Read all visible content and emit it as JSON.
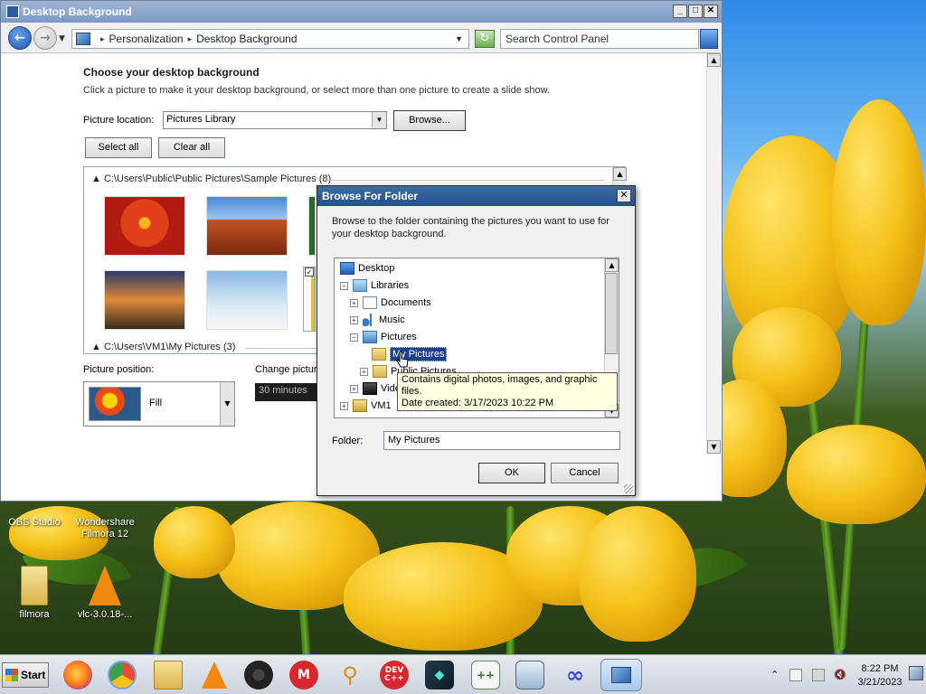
{
  "window": {
    "title": "Desktop Background",
    "buttons": {
      "minimize": "_",
      "maximize": "□",
      "close": "✕"
    }
  },
  "navbar": {
    "breadcrumb": [
      "Personalization",
      "Desktop Background"
    ],
    "search_placeholder": "Search Control Panel"
  },
  "page": {
    "heading": "Choose your desktop background",
    "instructions": "Click a picture to make it your desktop background, or select more than one picture to create a slide show.",
    "location_label": "Picture location:",
    "location_value": "Pictures Library",
    "browse_label": "Browse...",
    "select_all_label": "Select all",
    "clear_all_label": "Clear all",
    "groups": [
      {
        "label": "C:\\Users\\Public\\Public Pictures\\Sample Pictures (8)"
      },
      {
        "label": "C:\\Users\\VM1\\My Pictures (3)"
      }
    ],
    "position_label": "Picture position:",
    "position_value": "Fill",
    "change_label": "Change picture every:",
    "interval_value": "30 minutes"
  },
  "dialog": {
    "title": "Browse For Folder",
    "description": "Browse to the folder containing the pictures you want to use for your desktop background.",
    "tree": [
      {
        "label": "Desktop",
        "icon": "desktop-icon",
        "expander": ""
      },
      {
        "label": "Libraries",
        "icon": "libraries-icon",
        "expander": "−"
      },
      {
        "label": "Documents",
        "icon": "documents-icon",
        "expander": "+"
      },
      {
        "label": "Music",
        "icon": "music-icon",
        "expander": "+"
      },
      {
        "label": "Pictures",
        "icon": "pictures-icon",
        "expander": "−"
      },
      {
        "label": "My Pictures",
        "icon": "folder-icon",
        "expander": "",
        "selected": true
      },
      {
        "label": "Public Pictures",
        "icon": "folder-icon",
        "expander": "+"
      },
      {
        "label": "Videos",
        "icon": "video-icon",
        "expander": "+"
      },
      {
        "label": "VM1",
        "icon": "user-folder-icon",
        "expander": "+"
      }
    ],
    "tooltip_line1": "Contains digital photos, images, and graphic files.",
    "tooltip_line2": "Date created: 3/17/2023 10:22 PM",
    "folder_label": "Folder:",
    "folder_value": "My Pictures",
    "ok_label": "OK",
    "cancel_label": "Cancel"
  },
  "desktop_icons": [
    {
      "label": "OBS Studio",
      "icon": "obs-icon"
    },
    {
      "label": "Wondershare Filmora 12",
      "icon": "filmora-icon"
    },
    {
      "label": "filmora",
      "icon": "folder-icon"
    },
    {
      "label": "vlc-3.0.18-...",
      "icon": "vlc-icon"
    }
  ],
  "taskbar": {
    "start_label": "Start",
    "apps": [
      "firefox-icon",
      "chrome-icon",
      "file-explorer-icon",
      "vlc-icon",
      "obs-icon",
      "mega-icon",
      "search-tool-icon",
      "devcpp-icon",
      "filmora-icon",
      "notepadpp-icon",
      "window-app-icon",
      "infinity-app-icon",
      "control-panel-icon"
    ],
    "time": "8:22 PM",
    "date": "3/21/2023"
  },
  "colors": {
    "title_active": "#244f86",
    "selection": "#1f3f8f",
    "tooltip_bg": "#ffffe1"
  }
}
